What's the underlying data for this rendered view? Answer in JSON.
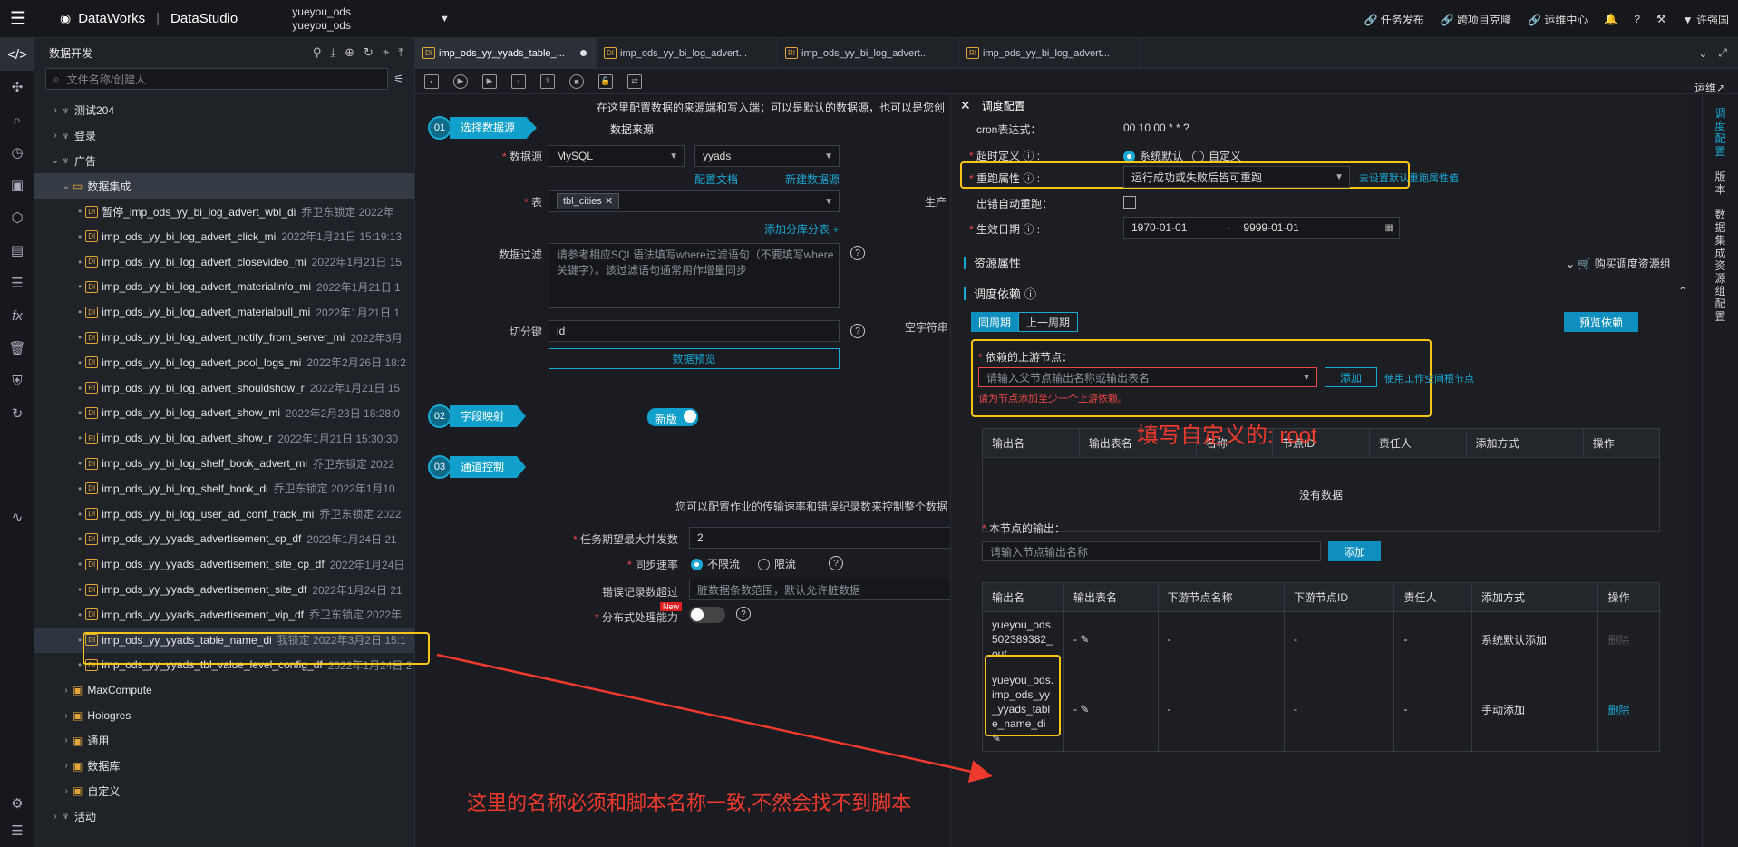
{
  "topbar": {
    "product": "DataWorks",
    "module": "DataStudio",
    "workspace_line1": "yueyou_ods",
    "workspace_line2": "yueyou_ods",
    "links": [
      "任务发布",
      "跨项目克隆",
      "运维中心"
    ],
    "user": "许强国"
  },
  "sidebar": {
    "title": "数据开发",
    "search_placeholder": "文件名称/创建人",
    "tree": [
      {
        "level": 1,
        "caret": ">",
        "label": "测试204",
        "kind": "biz"
      },
      {
        "level": 1,
        "caret": ">",
        "label": "登录",
        "kind": "biz"
      },
      {
        "level": 1,
        "caret": "v",
        "label": "广告",
        "kind": "biz"
      },
      {
        "level": 2,
        "caret": "v",
        "label": "数据集成",
        "kind": "folder"
      },
      {
        "level": 3,
        "badge": "DI",
        "label": "暂停_imp_ods_yy_bi_log_advert_wbl_di",
        "meta": "乔卫东锁定  2022年"
      },
      {
        "level": 3,
        "badge": "DI",
        "label": "imp_ods_yy_bi_log_advert_click_mi",
        "meta": "2022年1月21日 15:19:13"
      },
      {
        "level": 3,
        "badge": "DI",
        "label": "imp_ods_yy_bi_log_advert_closevideo_mi",
        "meta": "2022年1月21日 15"
      },
      {
        "level": 3,
        "badge": "DI",
        "label": "imp_ods_yy_bi_log_advert_materialinfo_mi",
        "meta": "2022年1月21日 1"
      },
      {
        "level": 3,
        "badge": "DI",
        "label": "imp_ods_yy_bi_log_advert_materialpull_mi",
        "meta": "2022年1月21日 1"
      },
      {
        "level": 3,
        "badge": "DI",
        "label": "imp_ods_yy_bi_log_advert_notify_from_server_mi",
        "meta": "2022年3月"
      },
      {
        "level": 3,
        "badge": "DI",
        "label": "imp_ods_yy_bi_log_advert_pool_logs_mi",
        "meta": "2022年2月26日 18:2"
      },
      {
        "level": 3,
        "badge": "RI",
        "label": "imp_ods_yy_bi_log_advert_shouldshow_r",
        "meta": "2022年1月21日 15"
      },
      {
        "level": 3,
        "badge": "DI",
        "label": "imp_ods_yy_bi_log_advert_show_mi",
        "meta": "2022年2月23日 18:28:0"
      },
      {
        "level": 3,
        "badge": "RI",
        "label": "imp_ods_yy_bi_log_advert_show_r",
        "meta": "2022年1月21日 15:30:30"
      },
      {
        "level": 3,
        "badge": "DI",
        "label": "imp_ods_yy_bi_log_shelf_book_advert_mi",
        "meta": "乔卫东锁定  2022"
      },
      {
        "level": 3,
        "badge": "DI",
        "label": "imp_ods_yy_bi_log_shelf_book_di",
        "meta": "乔卫东锁定  2022年1月10"
      },
      {
        "level": 3,
        "badge": "DI",
        "label": "imp_ods_yy_bi_log_user_ad_conf_track_mi",
        "meta": "乔卫东锁定  2022"
      },
      {
        "level": 3,
        "badge": "DI",
        "label": "imp_ods_yy_yyads_advertisement_cp_df",
        "meta": "2022年1月24日 21"
      },
      {
        "level": 3,
        "badge": "DI",
        "label": "imp_ods_yy_yyads_advertisement_site_cp_df",
        "meta": "2022年1月24日"
      },
      {
        "level": 3,
        "badge": "DI",
        "label": "imp_ods_yy_yyads_advertisement_site_df",
        "meta": "2022年1月24日 21"
      },
      {
        "level": 3,
        "badge": "DI",
        "label": "imp_ods_yy_yyads_advertisement_vip_df",
        "meta": "乔卫东锁定  2022年"
      },
      {
        "level": 3,
        "badge": "DI",
        "label": "imp_ods_yy_yyads_table_name_di",
        "meta": "我锁定  2022年3月2日 15:1",
        "selected": true
      },
      {
        "level": 3,
        "badge": "DI",
        "label": "imp_ods_yy_yyads_tbl_value_level_config_df",
        "meta": "2022年1月24日 2"
      },
      {
        "level": 2,
        "caret": ">",
        "label": "MaxCompute",
        "kind": "engine"
      },
      {
        "level": 2,
        "caret": ">",
        "label": "Hologres",
        "kind": "engine"
      },
      {
        "level": 2,
        "caret": ">",
        "label": "通用",
        "kind": "engine"
      },
      {
        "level": 2,
        "caret": ">",
        "label": "数据库",
        "kind": "engine"
      },
      {
        "level": 2,
        "caret": ">",
        "label": "自定义",
        "kind": "engine"
      },
      {
        "level": 1,
        "caret": ">",
        "label": "活动",
        "kind": "biz"
      }
    ]
  },
  "tabs": [
    {
      "label": "imp_ods_yy_yyads_table_...",
      "badge": "DI",
      "active": true
    },
    {
      "label": "imp_ods_yy_bi_log_advert...",
      "badge": "DI"
    },
    {
      "label": "imp_ods_yy_bi_log_advert...",
      "badge": "RI"
    },
    {
      "label": "imp_ods_yy_bi_log_advert...",
      "badge": "RI"
    }
  ],
  "ops_link": "运维↗",
  "form": {
    "notice": "在这里配置数据的来源端和写入端；可以是默认的数据源，也可以是您创",
    "step1": {
      "num": "01",
      "label": "选择数据源",
      "title": "数据来源"
    },
    "datasource_label": "数据源",
    "datasource_type": "MySQL",
    "datasource_name": "yyads",
    "config_doc": "配置文档",
    "new_datasource": "新建数据源",
    "table_label": "表",
    "table_tag": "tbl_cities",
    "add_shard": "添加分库分表 +",
    "filter_label": "数据过滤",
    "filter_placeholder": "请参考相应SQL语法填写where过滤语句（不要填写where关键字）。该过滤语句通常用作增量同步",
    "split_label": "切分键",
    "split_value": "id",
    "preview_btn": "数据预览",
    "right_cut1": "生产",
    "right_cut2": "空字符串",
    "step2": {
      "num": "02",
      "label": "字段映射"
    },
    "new_version": "新版",
    "step3": {
      "num": "03",
      "label": "通道控制"
    },
    "channel_notice": "您可以配置作业的传输速率和错误纪录数来控制整个数据",
    "concurrency_label": "任务期望最大并发数",
    "concurrency_value": "2",
    "speed_label": "同步速率",
    "speed_opt1": "不限流",
    "speed_opt2": "限流",
    "error_label": "错误记录数超过",
    "error_placeholder": "脏数据条数范围，默认允许脏数据",
    "distributed_label": "分布式处理能力",
    "new_badge": "New"
  },
  "panel": {
    "title": "调度配置",
    "cron_label": "cron表达式：",
    "cron_value": "00 10 00 * * ?",
    "timeout_label": "超时定义",
    "timeout_opt1": "系统默认",
    "timeout_opt2": "自定义",
    "rerun_label": "重跑属性",
    "rerun_value": "运行成功或失败后皆可重跑",
    "rerun_link": "去设置默认重跑属性值",
    "auto_retry_label": "出错自动重跑：",
    "date_label": "生效日期",
    "date_from": "1970-01-01",
    "date_sep": "-",
    "date_to": "9999-01-01",
    "resource_title": "资源属性",
    "buy_resource": "购买调度资源组",
    "dep_title": "调度依赖",
    "tab_same": "同周期",
    "tab_prev": "上一周期",
    "preview_dep": "预览依赖",
    "upstream_label": "依赖的上游节点：",
    "upstream_placeholder": "请输入父节点输出名称或输出表名",
    "add_btn": "添加",
    "use_root": "使用工作空间根节点",
    "upstream_error": "请为节点添加至少一个上游依赖。",
    "up_headers": [
      "输出名",
      "输出表名",
      "名称",
      "节点ID",
      "责任人",
      "添加方式",
      "操作"
    ],
    "no_data": "没有数据",
    "output_label": "本节点的输出：",
    "output_placeholder": "请输入节点输出名称",
    "output_add": "添加",
    "out_headers": [
      "输出名",
      "输出表名",
      "下游节点名称",
      "下游节点ID",
      "责任人",
      "添加方式",
      "操作"
    ],
    "out_rows": [
      {
        "name": "yueyou_ods.502389382_out",
        "table": "-",
        "down_name": "-",
        "down_id": "-",
        "owner": "-",
        "mode": "系统默认添加",
        "op": "删除",
        "op_enabled": false
      },
      {
        "name": "yueyou_ods.imp_ods_yy_yyads_table_name_di",
        "table": "-",
        "down_name": "-",
        "down_id": "-",
        "owner": "-",
        "mode": "手动添加",
        "op": "删除",
        "op_enabled": true
      }
    ]
  },
  "rail": [
    "调度配置",
    "版本",
    "数据集成资源组配置"
  ],
  "annotations": {
    "custom_root": "填写自定义的: root",
    "name_note": "这里的名称必须和脚本名称一致,不然会找不到脚本"
  },
  "colors": {
    "accent": "#1aa8d4",
    "highlight": "#f5c518",
    "annotation": "#f03a2e",
    "error": "#f04848"
  }
}
